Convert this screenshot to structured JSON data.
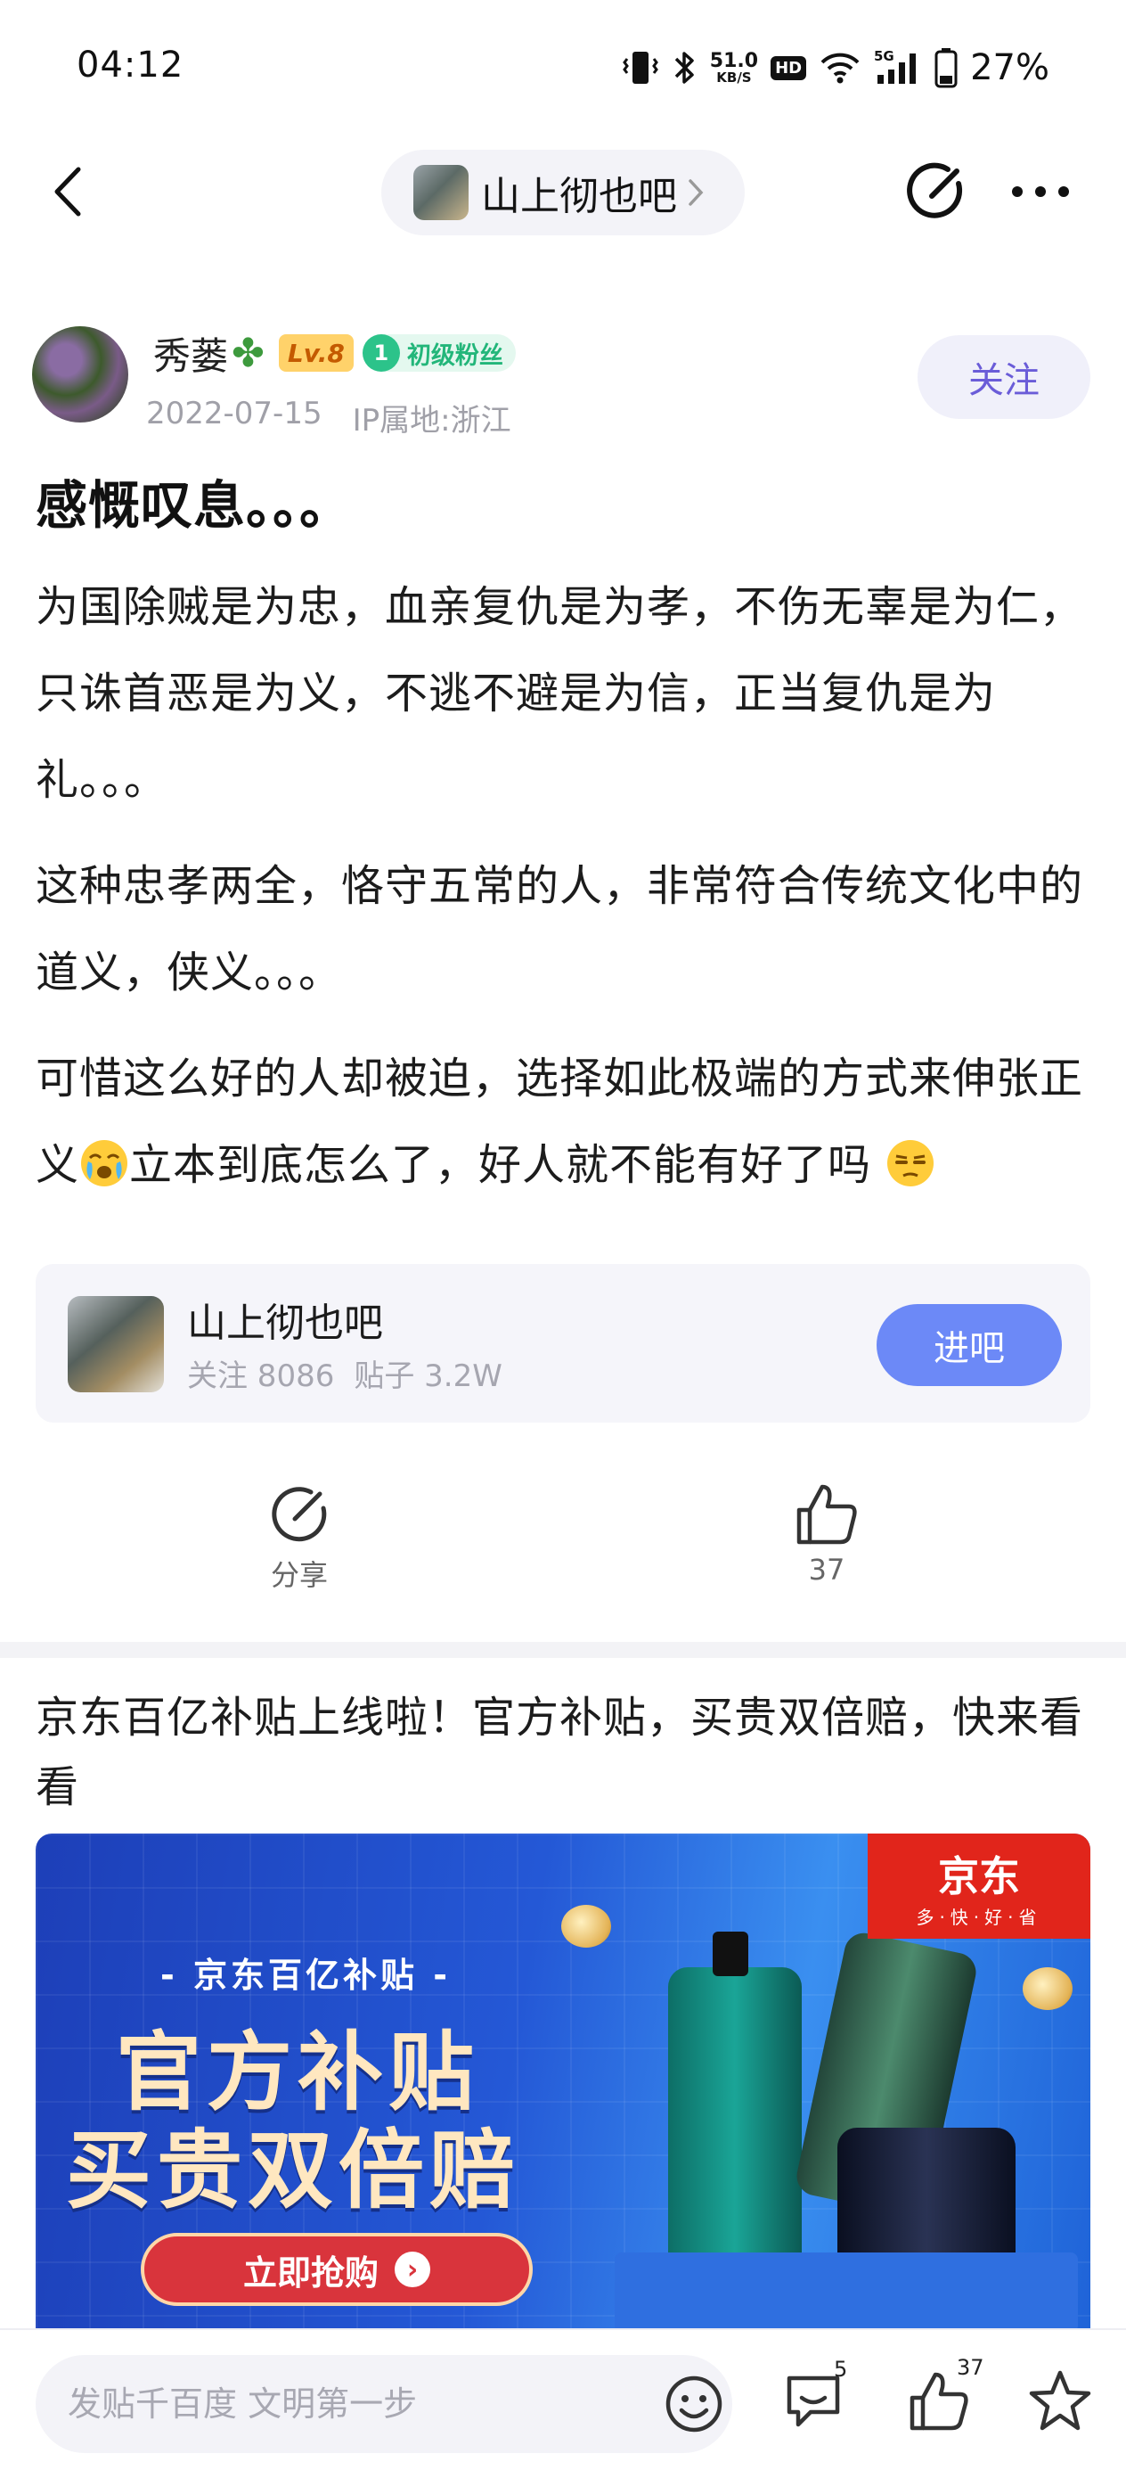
{
  "status_bar": {
    "time": "04:12",
    "net_speed_value": "51.0",
    "net_speed_unit": "KB/S",
    "hd_label": "HD",
    "net_type": "5G",
    "battery_percent": "27%"
  },
  "header": {
    "forum_name": "山上彻也吧"
  },
  "author": {
    "name": "秀蒌",
    "level_badge": "Lv.8",
    "fan_level": "1",
    "fan_label": "初级粉丝",
    "date": "2022-07-15",
    "ip_location": "IP属地:浙江",
    "follow_label": "关注"
  },
  "post": {
    "title": "感慨叹息。。。",
    "para1": "为国除贼是为忠，血亲复仇是为孝，不伤无辜是为仁，只诛首恶是为义，不逃不避是为信，正当复仇是为礼。。。",
    "para2": "这种忠孝两全，恪守五常的人，非常符合传统文化中的道义，侠义。。。",
    "para3_a": "可惜这么好的人却被迫，选择如此极端的方式来伸张正义",
    "para3_b": "立本到底怎么了，好人就不能有好了吗"
  },
  "forum_card": {
    "name": "山上彻也吧",
    "followers": "关注 8086",
    "posts": "贴子 3.2W",
    "enter_label": "进吧"
  },
  "actions": {
    "share_label": "分享",
    "like_count": "37"
  },
  "ad": {
    "text": "京东百亿补贴上线啦！官方补贴，买贵双倍赔，快来看看",
    "banner_sub": "- 京东百亿补贴 -",
    "banner_line1": "官方补贴",
    "banner_line2": "买贵双倍赔",
    "banner_cta": "立即抢购",
    "logo_main": "京东",
    "logo_sub": "多·快·好·省"
  },
  "bottom_bar": {
    "composer_placeholder": "发贴千百度 文明第一步",
    "comment_count": "5",
    "like_count": "37"
  },
  "colors": {
    "accent": "#6c89f7",
    "follow_text": "#6a5cd8",
    "jd_red": "#e1251b"
  }
}
